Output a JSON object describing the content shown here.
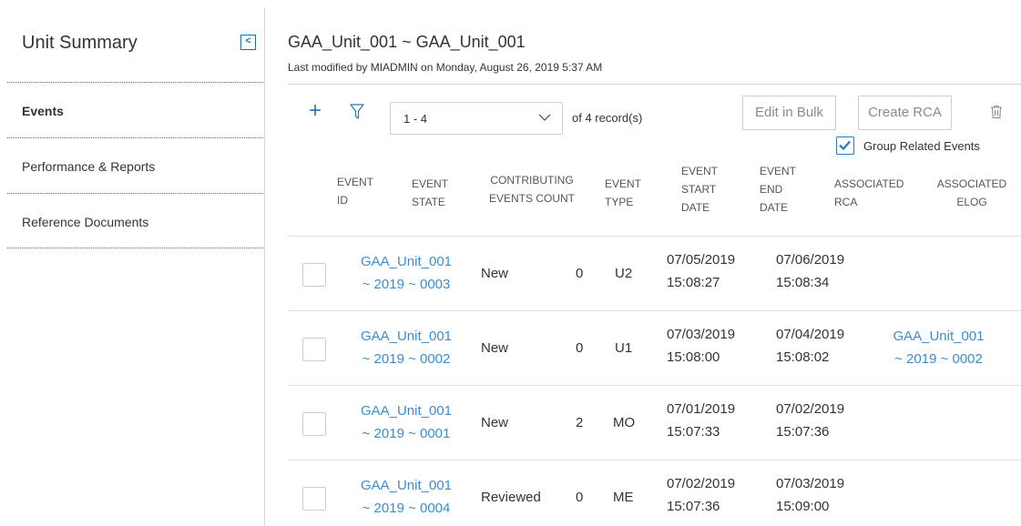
{
  "sidebar": {
    "title": "Unit Summary",
    "collapse_glyph": "<",
    "items": [
      {
        "label": "Events",
        "active": true
      },
      {
        "label": "Performance & Reports",
        "active": false
      },
      {
        "label": "Reference Documents",
        "active": false
      }
    ]
  },
  "header": {
    "title": "GAA_Unit_001 ~ GAA_Unit_001",
    "subtitle": "Last modified by MIADMIN on Monday, August 26, 2019 5:37 AM"
  },
  "toolbar": {
    "add_icon": "+",
    "filter_icon": "funnel-icon",
    "range_value": "1 - 4",
    "record_count": "of 4 record(s)",
    "edit_bulk_label": "Edit in Bulk",
    "create_rca_label": "Create RCA",
    "delete_icon": "trash-icon",
    "group_related_label": "Group Related Events",
    "group_related_checked": true
  },
  "colors": {
    "link": "#3b8dd0",
    "accent": "#2a7ab8",
    "border": "#cfcfcf"
  },
  "table": {
    "columns": {
      "event_id": [
        "EVENT",
        "ID"
      ],
      "event_state": [
        "EVENT",
        "STATE"
      ],
      "contributing": [
        "CONTRIBUTING",
        "EVENTS COUNT"
      ],
      "event_type": [
        "EVENT",
        "TYPE"
      ],
      "start_date": [
        "EVENT",
        "START",
        "DATE"
      ],
      "end_date": [
        "EVENT",
        "END",
        "DATE"
      ],
      "assoc_rca": [
        "ASSOCIATED",
        "RCA"
      ],
      "assoc_elog": [
        "ASSOCIATED",
        "ELOG"
      ]
    },
    "rows": [
      {
        "id_1": "GAA_Unit_001",
        "id_2": "~ 2019 ~ 0003",
        "state": "New",
        "count": "0",
        "type": "U2",
        "start_date": "07/05/2019",
        "start_time": "15:08:27",
        "end_date": "07/06/2019",
        "end_time": "15:08:34",
        "rca_1": "",
        "rca_2": ""
      },
      {
        "id_1": "GAA_Unit_001",
        "id_2": "~ 2019 ~ 0002",
        "state": "New",
        "count": "0",
        "type": "U1",
        "start_date": "07/03/2019",
        "start_time": "15:08:00",
        "end_date": "07/04/2019",
        "end_time": "15:08:02",
        "rca_1": "GAA_Unit_001",
        "rca_2": "~ 2019 ~ 0002"
      },
      {
        "id_1": "GAA_Unit_001",
        "id_2": "~ 2019 ~ 0001",
        "state": "New",
        "count": "2",
        "type": "MO",
        "start_date": "07/01/2019",
        "start_time": "15:07:33",
        "end_date": "07/02/2019",
        "end_time": "15:07:36",
        "rca_1": "",
        "rca_2": ""
      },
      {
        "id_1": "GAA_Unit_001",
        "id_2": "~ 2019 ~ 0004",
        "state": "Reviewed",
        "count": "0",
        "type": "ME",
        "start_date": "07/02/2019",
        "start_time": "15:07:36",
        "end_date": "07/03/2019",
        "end_time": "15:09:00",
        "rca_1": "",
        "rca_2": ""
      }
    ]
  }
}
